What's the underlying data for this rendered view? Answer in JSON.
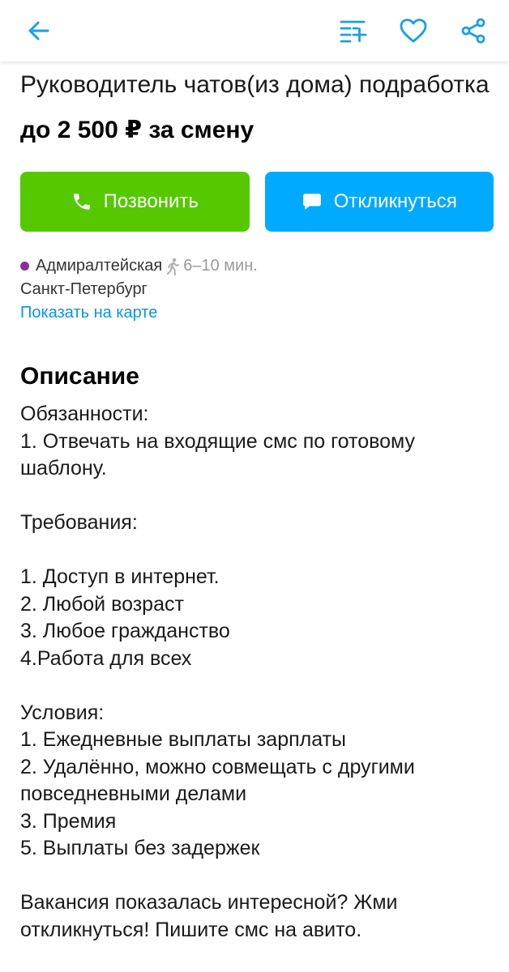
{
  "header": {
    "back_icon": "arrow-left-icon",
    "add_to_list_icon": "list-add-icon",
    "favorite_icon": "heart-icon",
    "share_icon": "share-icon",
    "accent_color": "#1a9ee8"
  },
  "listing": {
    "title": "Руководитель чатов(из дома) подработка",
    "price": "до 2 500 ₽ за смену"
  },
  "actions": {
    "call_label": "Позвонить",
    "call_color": "#55c800",
    "reply_label": "Откликнуться",
    "reply_color": "#00aaff"
  },
  "location": {
    "metro": "Адмиралтейская",
    "metro_color": "#8b2d9e",
    "walk_time": "6–10 мин.",
    "city": "Санкт-Петербург",
    "map_link": "Показать на карте"
  },
  "description": {
    "heading": "Описание",
    "text": "Обязанности:\n1. Отвечать на входящие смс по готовому шаблону.\n\nТребования:\n\n1. Доступ в интернет.\n2. Любой возраст\n3. Любое гражданство\n4.Работа для всех\n\nУсловия:\n1. Ежедневные выплаты зарплаты\n2. Удалённо, можно совмещать с другими повседневными делами\n3. Премия\n5. Выплаты без задержек\n\nВакансия показалась интересной? Жми откликнуться! Пишите смс на авито."
  }
}
